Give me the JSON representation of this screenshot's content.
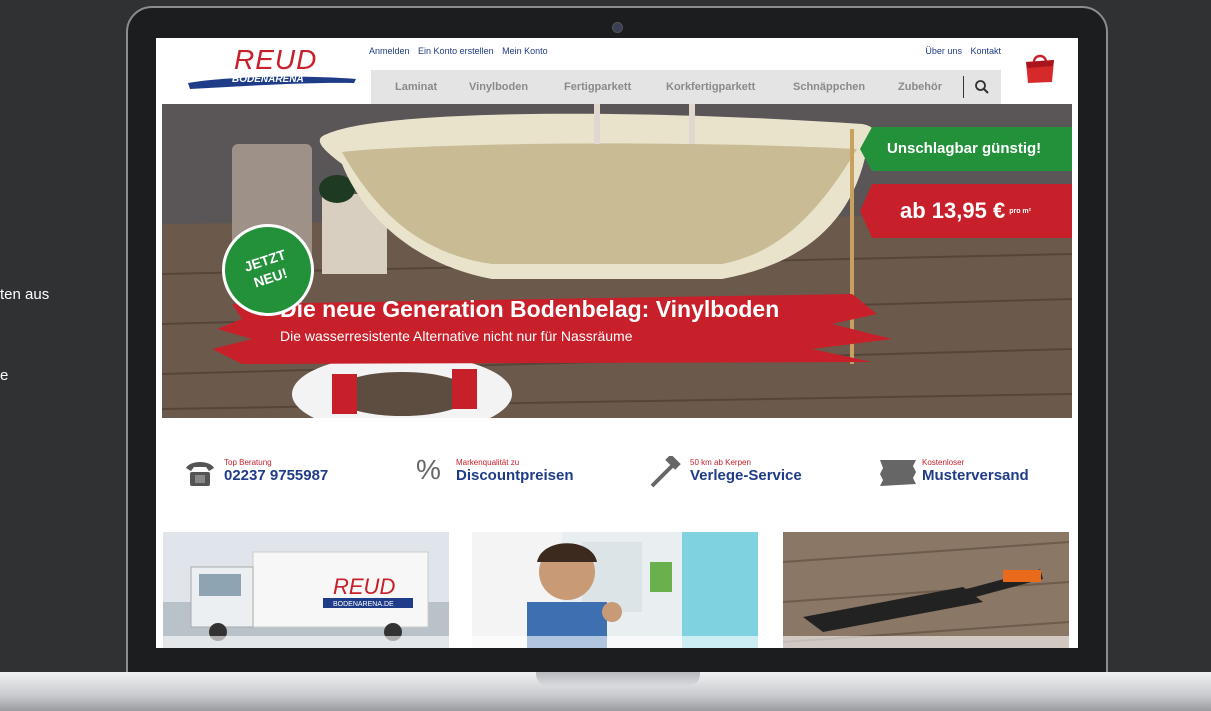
{
  "background": {
    "line1": "ten aus",
    "line2": "e"
  },
  "site": {
    "logo_text": "REUD",
    "logo_sub": "BODENARENA",
    "top_links": [
      "Anmelden",
      "Ein Konto erstellen",
      "Mein Konto"
    ],
    "top_links_right": [
      "Über uns",
      "Kontakt"
    ],
    "nav": [
      "Laminat",
      "Vinylboden",
      "Fertigparkett",
      "Korkfertigparkett",
      "Schnäppchen",
      "Zubehör"
    ],
    "hero": {
      "badge_green": "Unschlagbar günstig!",
      "price": "ab 13,95 €",
      "price_unit": "pro m²",
      "jetzt": "JETZT",
      "neu": "NEU!",
      "title": "Die neue Generation Bodenbelag: Vinylboden",
      "subtitle": "Die wasserresistente Alternative nicht nur für Nassräume"
    },
    "features": [
      {
        "small": "Top Beratung",
        "big": "02237 9755987",
        "icon": "phone-icon"
      },
      {
        "small": "Markenqualität zu",
        "big": "Discountpreisen",
        "icon": "percent-icon"
      },
      {
        "small": "50 km ab Kerpen",
        "big": "Verlege-Service",
        "icon": "hammer-icon"
      },
      {
        "small": "Kostenloser",
        "big": "Musterversand",
        "icon": "flooring-sample-icon"
      }
    ],
    "cards": [
      {
        "truck_logo": "REUD",
        "truck_sub": "BODENARENA.DE"
      }
    ],
    "colors": {
      "brand_red": "#c8202a",
      "brand_blue": "#1f3c88",
      "accent_green": "#22913a"
    }
  }
}
